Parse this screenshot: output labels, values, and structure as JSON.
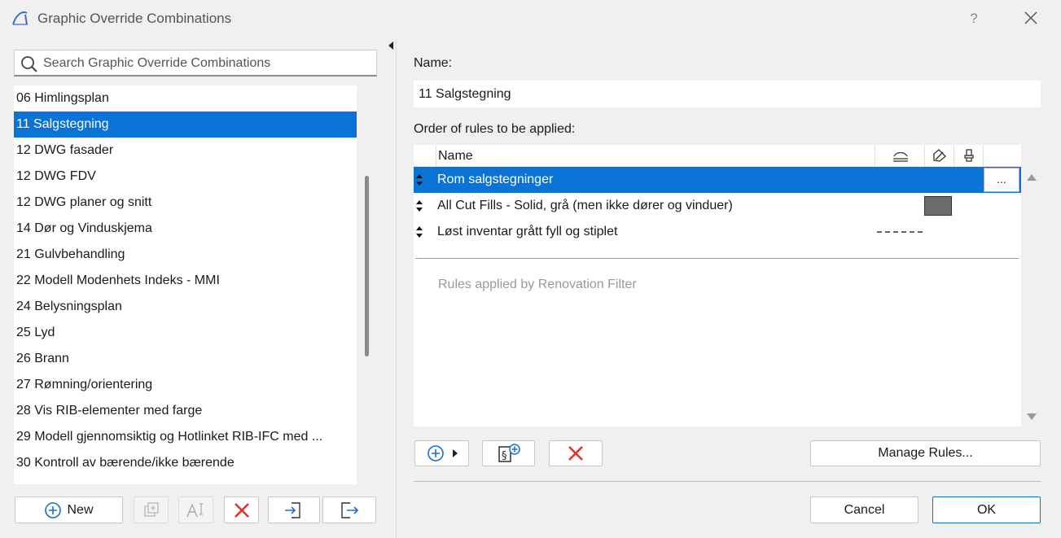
{
  "window": {
    "title": "Graphic Override Combinations",
    "help_label": "?"
  },
  "search": {
    "placeholder": "Search Graphic Override Combinations",
    "value": ""
  },
  "combinations": [
    {
      "label": "06 Himlingsplan",
      "selected": false
    },
    {
      "label": "11 Salgstegning",
      "selected": true
    },
    {
      "label": "12 DWG fasader",
      "selected": false
    },
    {
      "label": "12 DWG FDV",
      "selected": false
    },
    {
      "label": "12 DWG planer og snitt",
      "selected": false
    },
    {
      "label": "14 Dør og Vinduskjema",
      "selected": false
    },
    {
      "label": "21 Gulvbehandling",
      "selected": false
    },
    {
      "label": "22 Modell Modenhets Indeks - MMI",
      "selected": false
    },
    {
      "label": "24 Belysningsplan",
      "selected": false
    },
    {
      "label": "25 Lyd",
      "selected": false
    },
    {
      "label": "26 Brann",
      "selected": false
    },
    {
      "label": "27 Rømning/orientering",
      "selected": false
    },
    {
      "label": "28 Vis RIB-elementer med farge",
      "selected": false
    },
    {
      "label": "29 Modell gjennomsiktig og Hotlinket RIB-IFC med ...",
      "selected": false
    },
    {
      "label": "30 Kontroll av bærende/ikke bærende",
      "selected": false
    }
  ],
  "left_toolbar": {
    "new_label": "New"
  },
  "detail": {
    "name_label": "Name:",
    "name_value": "11 Salgstegning",
    "order_label": "Order of rules to be applied:",
    "table_header_name": "Name",
    "rules": [
      {
        "name": "Rom salgstegninger",
        "selected": true,
        "more_label": "...",
        "cut_fill_color": "",
        "line_type": ""
      },
      {
        "name": "All Cut Fills - Solid, grå (men ikke dører og vinduer)",
        "selected": false,
        "cut_fill_color": "#6c6c6c",
        "line_type": ""
      },
      {
        "name": "Løst inventar grått fyll og stiplet",
        "selected": false,
        "cut_fill_color": "",
        "line_type": "dashed"
      }
    ],
    "renovation_text": "Rules applied by Renovation Filter",
    "manage_rules_label": "Manage Rules..."
  },
  "footer": {
    "cancel_label": "Cancel",
    "ok_label": "OK"
  },
  "colors": {
    "selection": "#0a74d6",
    "delete_red": "#e0332b",
    "add_blue": "#1a6fd1"
  }
}
